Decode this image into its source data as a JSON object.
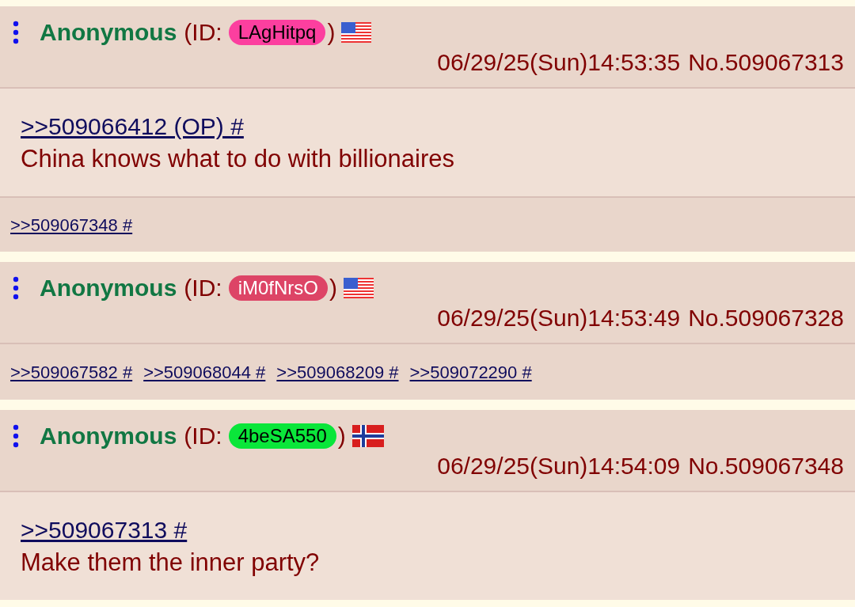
{
  "posts": [
    {
      "name": "Anonymous",
      "id_label": "(ID:",
      "id": {
        "text": "LAgHitpq",
        "color": "#fc3f9f",
        "light_text": false
      },
      "id_close": ")",
      "flag": {
        "kind": "us"
      },
      "datetime": "06/29/25(Sun)14:53:35",
      "number": "No.509067313",
      "quote_links": [
        ">>509066412 (OP) #"
      ],
      "comment": "China knows what to do with billionaires",
      "replies": [
        ">>509067348 #"
      ]
    },
    {
      "name": "Anonymous",
      "id_label": "(ID:",
      "id": {
        "text": "iM0fNrsO",
        "color": "#dd4466",
        "light_text": true
      },
      "id_close": ")",
      "flag": {
        "kind": "us"
      },
      "datetime": "06/29/25(Sun)14:53:49",
      "number": "No.509067328",
      "replies": [
        ">>509067582 #",
        ">>509068044 #",
        ">>509068209 #",
        ">>509072290 #"
      ]
    },
    {
      "name": "Anonymous",
      "id_label": "(ID:",
      "id": {
        "text": "4beSA550",
        "color": "#0ae63a",
        "light_text": false
      },
      "id_close": ")",
      "flag": {
        "kind": "no"
      },
      "datetime": "06/29/25(Sun)14:54:09",
      "number": "No.509067348",
      "quote_links": [
        ">>509067313 #"
      ],
      "comment": "Make them the inner party?"
    }
  ]
}
